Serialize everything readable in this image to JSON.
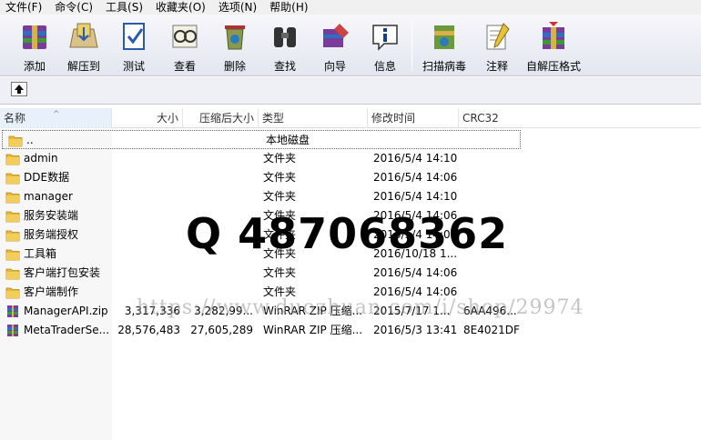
{
  "menu": {
    "items": [
      "文件(F)",
      "命令(C)",
      "工具(S)",
      "收藏夹(O)",
      "选项(N)",
      "帮助(H)"
    ]
  },
  "toolbar": {
    "buttons": [
      {
        "label": "添加",
        "icon": "add-archive-icon"
      },
      {
        "label": "解压到",
        "icon": "extract-to-icon"
      },
      {
        "label": "测试",
        "icon": "test-archive-icon"
      },
      {
        "label": "查看",
        "icon": "view-icon"
      },
      {
        "label": "删除",
        "icon": "delete-icon"
      },
      {
        "label": "查找",
        "icon": "find-icon"
      },
      {
        "label": "向导",
        "icon": "wizard-icon"
      },
      {
        "label": "信息",
        "icon": "info-icon"
      },
      {
        "label": "扫描病毒",
        "icon": "scan-virus-icon"
      },
      {
        "label": "注释",
        "icon": "comment-icon"
      },
      {
        "label": "自解压格式",
        "icon": "sfx-icon"
      }
    ]
  },
  "columns": {
    "name": "名称",
    "size": "大小",
    "packed": "压缩后大小",
    "type": "类型",
    "modified": "修改时间",
    "crc": "CRC32"
  },
  "files": [
    {
      "name": "..",
      "size": "",
      "packed": "",
      "type": "本地磁盘",
      "modified": "",
      "crc": "",
      "kind": "folder"
    },
    {
      "name": "admin",
      "size": "",
      "packed": "",
      "type": "文件夹",
      "modified": "2016/5/4 14:10",
      "crc": "",
      "kind": "folder"
    },
    {
      "name": "DDE数据",
      "size": "",
      "packed": "",
      "type": "文件夹",
      "modified": "2016/5/4 14:06",
      "crc": "",
      "kind": "folder"
    },
    {
      "name": "manager",
      "size": "",
      "packed": "",
      "type": "文件夹",
      "modified": "2016/5/4 14:10",
      "crc": "",
      "kind": "folder"
    },
    {
      "name": "服务安装端",
      "size": "",
      "packed": "",
      "type": "文件夹",
      "modified": "2016/5/4 14:06",
      "crc": "",
      "kind": "folder"
    },
    {
      "name": "服务端授权",
      "size": "",
      "packed": "",
      "type": "文件夹",
      "modified": "2016/5/4 14:06",
      "crc": "",
      "kind": "folder"
    },
    {
      "name": "工具箱",
      "size": "",
      "packed": "",
      "type": "文件夹",
      "modified": "2016/10/18 1...",
      "crc": "",
      "kind": "folder"
    },
    {
      "name": "客户端打包安装",
      "size": "",
      "packed": "",
      "type": "文件夹",
      "modified": "2016/5/4 14:06",
      "crc": "",
      "kind": "folder"
    },
    {
      "name": "客户端制作",
      "size": "",
      "packed": "",
      "type": "文件夹",
      "modified": "2016/5/4 14:06",
      "crc": "",
      "kind": "folder"
    },
    {
      "name": "ManagerAPI.zip",
      "size": "3,317,336",
      "packed": "3,282,99...",
      "type": "WinRAR ZIP 压缩...",
      "modified": "2015/7/17 1...",
      "crc": "6AA496...",
      "kind": "archive"
    },
    {
      "name": "MetaTraderSe...",
      "size": "28,576,483",
      "packed": "27,605,289",
      "type": "WinRAR ZIP 压缩...",
      "modified": "2016/5/3 13:41",
      "crc": "8E4021DF",
      "kind": "archive"
    }
  ],
  "overlay": {
    "big_text": "Q 487068362",
    "url_text": "https://www.duozhuan.com/i/shop/29974"
  },
  "colors": {
    "folder": "#e8b838",
    "selection_border": "#666666",
    "header_highlight": "#e8f1fb"
  }
}
